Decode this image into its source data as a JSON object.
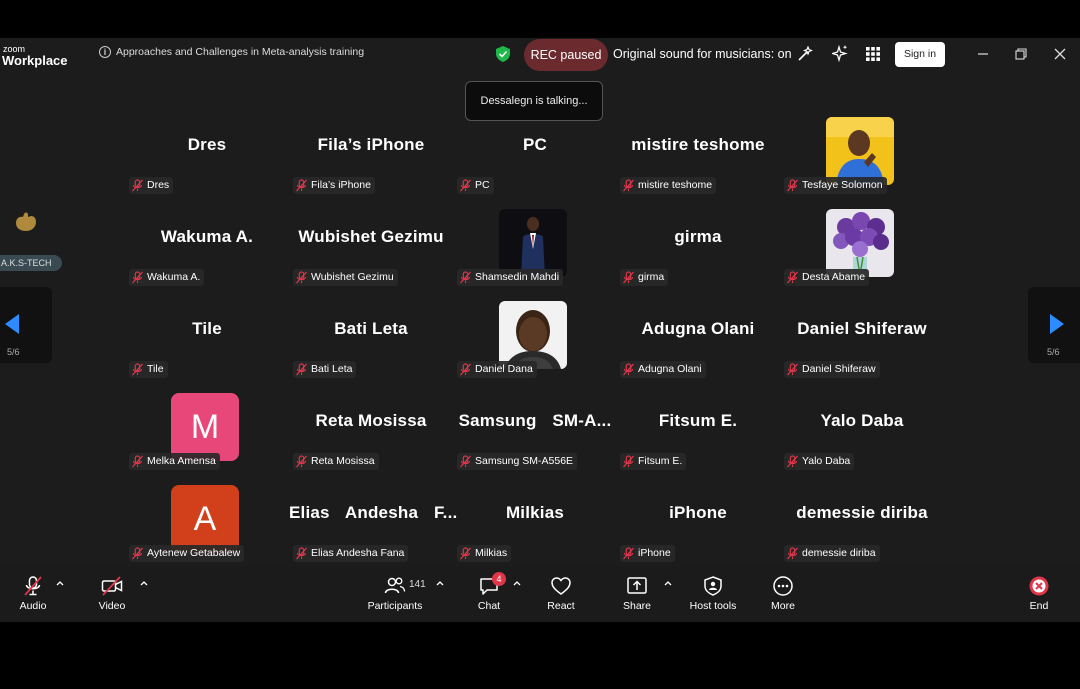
{
  "titlebar": {
    "logo_small": "zoom",
    "logo_big": "Workplace",
    "meeting_title": "Approaches and Challenges in Meta-analysis training",
    "rec_status": "REC paused",
    "sound_status": "Original sound for musicians: on",
    "signin_label": "Sign in"
  },
  "talking_indicator": "Dessalegn is talking...",
  "side": {
    "hand_tag": "A.K.S-TECH",
    "pager_left": "5/6",
    "pager_right": "5/6"
  },
  "grid": [
    {
      "display": "Dres",
      "label": "Dres"
    },
    {
      "display": "Fila’s iPhone",
      "label": "Fila’s iPhone"
    },
    {
      "display": "PC",
      "label": "PC"
    },
    {
      "display": "mistire teshome",
      "label": "mistire teshome"
    },
    {
      "display": "",
      "label": "Tesfaye Solomon",
      "avatar": "photo-man-yellow"
    },
    {
      "display": "Wakuma A.",
      "label": "Wakuma A."
    },
    {
      "display": "Wubishet Gezimu",
      "label": "Wubishet Gezimu"
    },
    {
      "display": "",
      "label": "Shamsedin Mahdi",
      "avatar": "photo-man-suit"
    },
    {
      "display": "girma",
      "label": "girma"
    },
    {
      "display": "",
      "label": "Desta Abame",
      "avatar": "photo-flowers"
    },
    {
      "display": "Tile",
      "label": "Tile"
    },
    {
      "display": "Bati Leta",
      "label": "Bati Leta"
    },
    {
      "display": "",
      "label": "Daniel Dana",
      "avatar": "photo-man-portrait"
    },
    {
      "display": "Adugna Olani",
      "label": "Adugna Olani"
    },
    {
      "display": "Daniel Shiferaw",
      "label": "Daniel Shiferaw"
    },
    {
      "display": "",
      "label": "Melka Amensa",
      "letter": "M",
      "color": "#e8477a"
    },
    {
      "display": "Reta Mosissa",
      "label": "Reta Mosissa"
    },
    {
      "display": "Samsung  SM-A...",
      "label": "Samsung SM-A556E"
    },
    {
      "display": "Fitsum E.",
      "label": "Fitsum E."
    },
    {
      "display": "Yalo Daba",
      "label": "Yalo Daba"
    },
    {
      "display": "",
      "label": "Aytenew Getabalew",
      "letter": "A",
      "color": "#d1401a"
    },
    {
      "display": "Elias  Andesha  F...",
      "label": "Elias Andesha Fana"
    },
    {
      "display": "Milkias",
      "label": "Milkias"
    },
    {
      "display": "iPhone",
      "label": "iPhone"
    },
    {
      "display": "demessie diriba",
      "label": "demessie diriba"
    }
  ],
  "toolbar": {
    "audio": "Audio",
    "video": "Video",
    "participants": "Participants",
    "participants_count": "141",
    "chat": "Chat",
    "chat_badge": "4",
    "react": "React",
    "share": "Share",
    "host_tools": "Host tools",
    "more": "More",
    "end": "End"
  },
  "colors": {
    "rec_badge": "#6b2a2e",
    "mute_red": "#e0364a",
    "stage_bg": "#1c1c1c",
    "pager_arrow": "#2d8cff"
  }
}
